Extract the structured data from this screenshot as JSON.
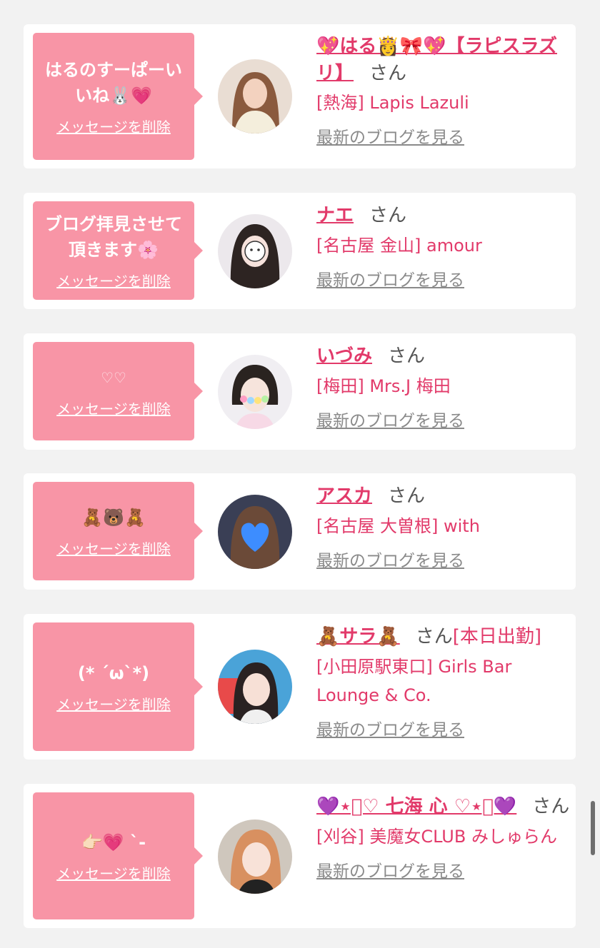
{
  "colors": {
    "page_bg": "#f2f2f2",
    "bubble_bg": "#f895a6",
    "name_pink": "#e23a6a",
    "link_gray": "#8a8a8a"
  },
  "common": {
    "delete_label": "メッセージを削除",
    "san": "さん",
    "blog_label": "最新のブログを見る"
  },
  "items": [
    {
      "message": "はるのすーぱーい\nいね🐰💗",
      "name": "💖はる👸🎀💖【ラピスラズリ】",
      "status": "",
      "shop": "[熱海] Lapis Lazuli"
    },
    {
      "message": "ブログ拝見させて\n頂きます🌸",
      "name": "ナエ",
      "status": "",
      "shop": "[名古屋 金山] amour"
    },
    {
      "message": "♡♡",
      "name": "いづみ",
      "status": "",
      "shop": "[梅田] Mrs.J 梅田"
    },
    {
      "message": "🧸🐻🧸",
      "name": "アスカ",
      "status": "",
      "shop": "[名古屋 大曽根] with"
    },
    {
      "message": "(* ´ω`*)",
      "name": "🧸サラ🧸",
      "status": "[本日出勤]",
      "shop": "[小田原駅東口] Girls Bar Lounge & Co."
    },
    {
      "message": "👉🏻💗 ˋ-",
      "name": "💜⋆͛♡ 七海 心 ♡⋆͛💜",
      "status": "",
      "shop": "[刈谷] 美魔女CLUB みしゅらん"
    }
  ]
}
